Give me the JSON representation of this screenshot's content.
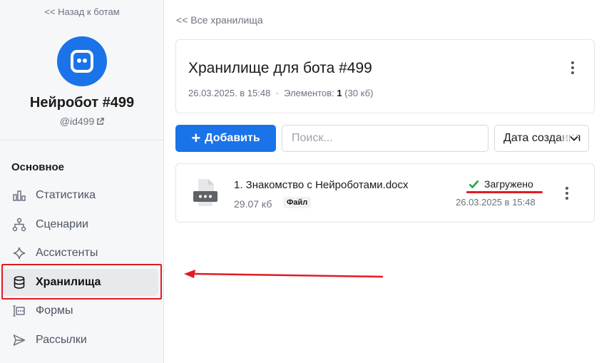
{
  "sidebar": {
    "back_link": "<< Назад к ботам",
    "bot_name": "Нейробот #499",
    "bot_handle": "@id499",
    "section_title": "Основное",
    "items": [
      {
        "label": "Статистика",
        "icon": "bar-chart-icon"
      },
      {
        "label": "Сценарии",
        "icon": "flow-icon"
      },
      {
        "label": "Ассистенты",
        "icon": "sparkle-icon"
      },
      {
        "label": "Хранилища",
        "icon": "database-icon",
        "active": true
      },
      {
        "label": "Формы",
        "icon": "form-icon"
      },
      {
        "label": "Рассылки",
        "icon": "send-icon"
      }
    ]
  },
  "main": {
    "back_link": "<< Все хранилища",
    "storage": {
      "title": "Хранилище для бота #499",
      "created": "26.03.2025. в 15:48",
      "separator": "·",
      "elements_label": "Элементов:",
      "elements_count": "1",
      "elements_size": "(30 кб)"
    },
    "toolbar": {
      "add_icon": "+",
      "add_label": "Добавить",
      "search_placeholder": "Поиск...",
      "sort_value": "Дата создания"
    },
    "files": [
      {
        "name": "1. Знакомство с Нейроботами.docx",
        "size": "29.07 кб",
        "type": "Файл",
        "status": "Загружено",
        "date": "26.03.2025 в 15:48"
      }
    ]
  },
  "colors": {
    "accent": "#1a73e8",
    "annotation": "#e21b23",
    "success": "#22a447"
  }
}
